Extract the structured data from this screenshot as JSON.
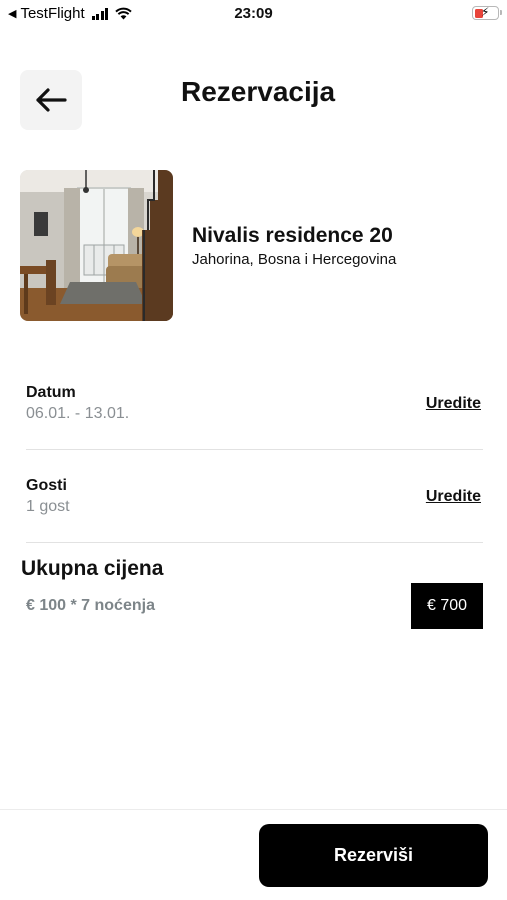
{
  "status_bar": {
    "back_app": "TestFlight",
    "time": "23:09"
  },
  "header": {
    "title": "Rezervacija",
    "back_icon": "arrow-left-icon"
  },
  "property": {
    "name": "Nivalis residence 20",
    "location": "Jahorina, Bosna i Hercegovina"
  },
  "details": {
    "date": {
      "label": "Datum",
      "value": "06.01. - 13.01.",
      "edit_label": "Uredite"
    },
    "guests": {
      "label": "Gosti",
      "value": "1 gost",
      "edit_label": "Uredite"
    }
  },
  "total": {
    "title": "Ukupna cijena",
    "breakdown": "€ 100 * 7 noćenja",
    "amount": "€ 700"
  },
  "actions": {
    "reserve_label": "Rezerviši"
  },
  "colors": {
    "accent": "#000000",
    "muted_text": "#8a8f93",
    "battery_low": "#e8443a"
  }
}
